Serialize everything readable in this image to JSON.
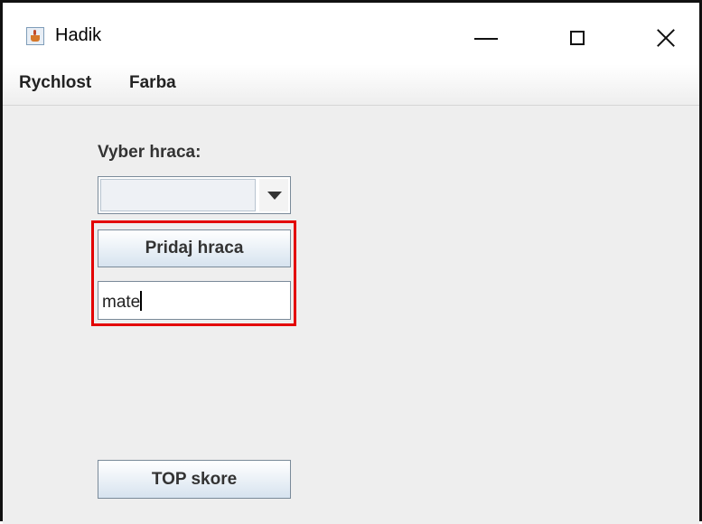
{
  "window": {
    "title": "Hadik",
    "icon": "java-cup-icon"
  },
  "controls": {
    "minimize": "minimize-icon",
    "maximize": "maximize-icon",
    "close": "close-icon"
  },
  "menu": {
    "items": [
      {
        "label": "Rychlost"
      },
      {
        "label": "Farba"
      }
    ]
  },
  "form": {
    "player_label": "Vyber hraca:",
    "player_select_value": "",
    "add_button_label": "Pridaj hraca",
    "name_input_value": "mate",
    "top_button_label": "TOP skore"
  },
  "colors": {
    "highlight": "#e30000",
    "background": "#eeeeee"
  }
}
